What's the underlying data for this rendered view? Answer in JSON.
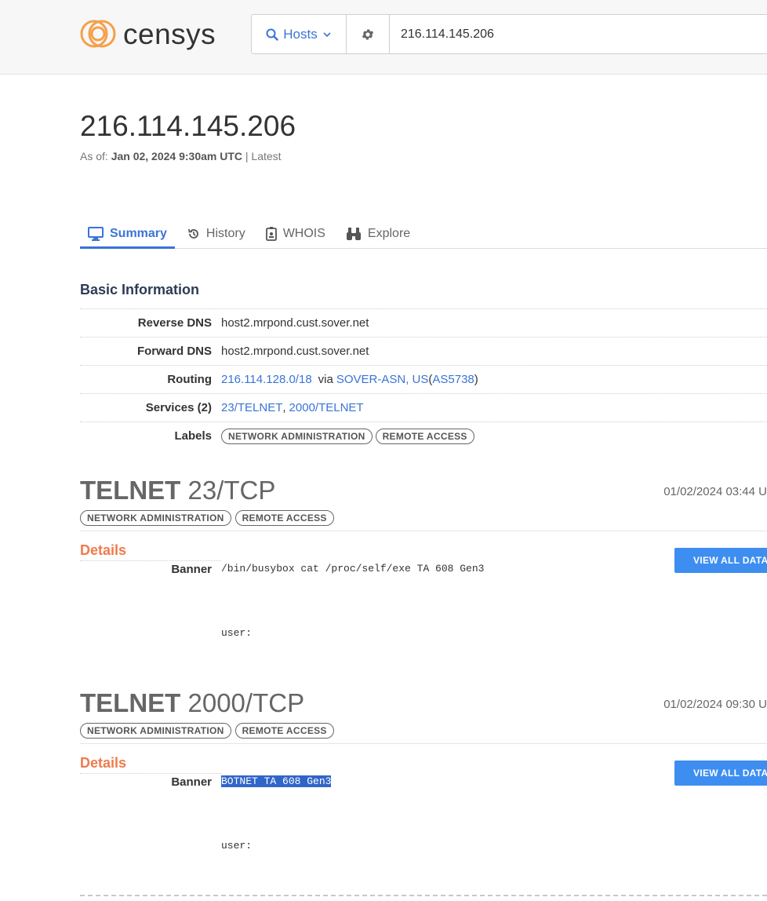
{
  "header": {
    "logo_text": "censys",
    "search_type": "Hosts",
    "search_value": "216.114.145.206"
  },
  "host": {
    "ip": "216.114.145.206",
    "as_of_label": "As of:",
    "as_of_date": "Jan 02, 2024 9:30am UTC",
    "as_of_suffix": "| Latest"
  },
  "tabs": [
    {
      "label": "Summary"
    },
    {
      "label": "History"
    },
    {
      "label": "WHOIS"
    },
    {
      "label": "Explore"
    }
  ],
  "basic_info": {
    "title": "Basic Information",
    "reverse_dns_key": "Reverse DNS",
    "reverse_dns": "host2.mrpond.cust.sover.net",
    "forward_dns_key": "Forward DNS",
    "forward_dns": "host2.mrpond.cust.sover.net",
    "routing_key": "Routing",
    "routing_prefix": "216.114.128.0/18",
    "routing_via": "via",
    "routing_asn_name": "SOVER-ASN, US",
    "routing_asn_open": "(",
    "routing_asn": "AS5738",
    "routing_asn_close": ")",
    "services_key": "Services (2)",
    "services": [
      "23/TELNET",
      "2000/TELNET"
    ],
    "services_sep": ",",
    "labels_key": "Labels",
    "labels": [
      "NETWORK ADMINISTRATION",
      "REMOTE ACCESS"
    ]
  },
  "services": [
    {
      "protocol": "TELNET",
      "port": "23/TCP",
      "date": "01/02/2024 03:44 U",
      "labels": [
        "NETWORK ADMINISTRATION",
        "REMOTE ACCESS"
      ],
      "details_title": "Details",
      "view_button": "VIEW ALL DATA",
      "banner_key": "Banner",
      "banner_line1": "/bin/busybox cat /proc/self/exe TA 608 Gen3",
      "banner_line2": "user:"
    },
    {
      "protocol": "TELNET",
      "port": "2000/TCP",
      "date": "01/02/2024 09:30 U",
      "labels": [
        "NETWORK ADMINISTRATION",
        "REMOTE ACCESS"
      ],
      "details_title": "Details",
      "view_button": "VIEW ALL DATA",
      "banner_key": "Banner",
      "banner_line1": "BOTNET TA 608 Gen3",
      "banner_line2": "user:"
    }
  ],
  "colors": {
    "accent_blue": "#3a74d6",
    "details_orange": "#f07a4c",
    "button_blue": "#3d8ef0",
    "logo_orange": "#f5a04a"
  }
}
